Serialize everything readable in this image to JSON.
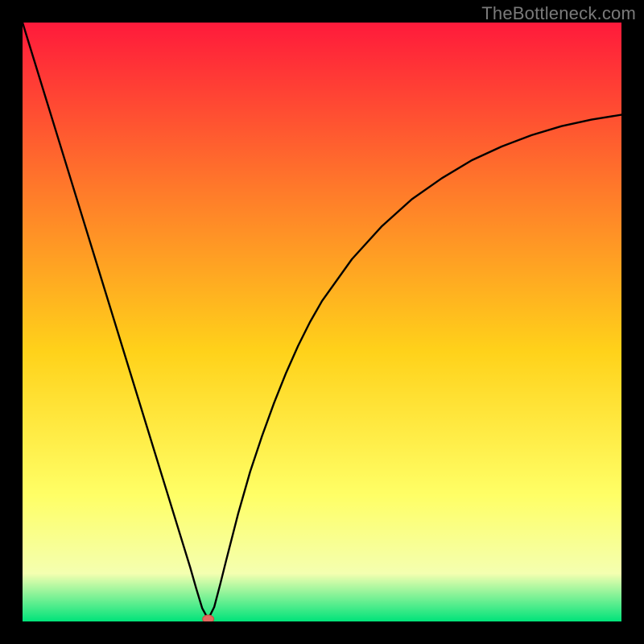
{
  "watermark": "TheBottleneck.com",
  "colors": {
    "frame": "#000000",
    "gradient_top": "#ff1a3b",
    "gradient_mid_upper": "#ff7a2a",
    "gradient_mid": "#ffd21a",
    "gradient_mid_lower": "#ffff66",
    "gradient_lower": "#f4ffb0",
    "gradient_bottom": "#00e37a",
    "curve": "#000000",
    "marker_fill": "#e26a5f",
    "marker_stroke": "#c74b3f"
  },
  "chart_data": {
    "type": "line",
    "title": "",
    "xlabel": "",
    "ylabel": "",
    "xlim": [
      0,
      100
    ],
    "ylim": [
      0,
      100
    ],
    "series": [
      {
        "name": "bottleneck-curve",
        "x": [
          0,
          2,
          4,
          6,
          8,
          10,
          12,
          14,
          16,
          18,
          20,
          22,
          24,
          26,
          28,
          29,
          30,
          31,
          32,
          33,
          34,
          36,
          38,
          40,
          42,
          44,
          46,
          48,
          50,
          55,
          60,
          65,
          70,
          75,
          80,
          85,
          90,
          95,
          100
        ],
        "y": [
          100,
          93.5,
          87,
          80.5,
          74,
          67.5,
          61,
          54.5,
          48,
          41.5,
          35,
          28.5,
          22,
          15.5,
          9,
          5.5,
          2.2,
          0.4,
          2.4,
          6.2,
          10.2,
          18,
          25,
          31,
          36.5,
          41.5,
          46,
          50,
          53.5,
          60.5,
          66,
          70.5,
          74,
          77,
          79.3,
          81.2,
          82.7,
          83.8,
          84.6
        ]
      }
    ],
    "marker": {
      "x": 31,
      "y": 0.4
    },
    "legend": []
  }
}
